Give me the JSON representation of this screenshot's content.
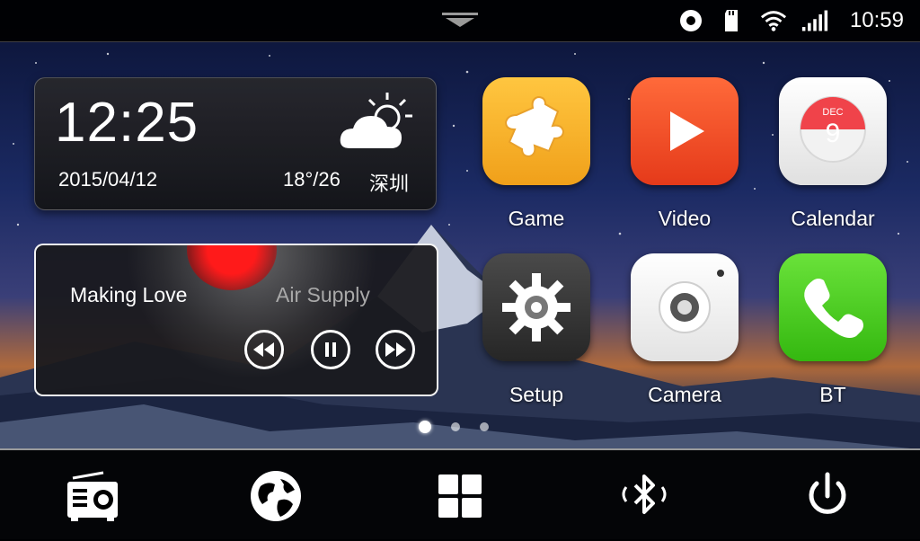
{
  "status_bar": {
    "time": "10:59",
    "icons": [
      "record-icon",
      "sd-card-icon",
      "wifi-icon",
      "signal-icon"
    ],
    "pull_handle": "chevron-down-icon"
  },
  "clock_widget": {
    "time": "12:25",
    "date": "2015/04/12",
    "temperature": "18°/26",
    "city": "深圳",
    "weather_icon": "partly-cloudy-icon"
  },
  "music_widget": {
    "title": "Making Love",
    "artist": "Air Supply",
    "controls": [
      "rewind",
      "pause",
      "fast-forward"
    ]
  },
  "apps": [
    {
      "label": "Game",
      "icon": "puzzle-icon",
      "color": "#f5a91f"
    },
    {
      "label": "Video",
      "icon": "play-icon",
      "color": "#f04a22"
    },
    {
      "label": "Calendar",
      "icon": "calendar-icon",
      "color": "#f1f1f1",
      "month": "DEC",
      "day": "9"
    },
    {
      "label": "Setup",
      "icon": "gear-icon",
      "color": "#3a3a3a"
    },
    {
      "label": "Camera",
      "icon": "camera-icon",
      "color": "#eeeeee"
    },
    {
      "label": "BT",
      "icon": "phone-icon",
      "color": "#4ccf1d"
    }
  ],
  "pager": {
    "pages": 3,
    "active": 0
  },
  "dock": [
    "radio-icon",
    "globe-icon",
    "apps-grid-icon",
    "bluetooth-icon",
    "power-icon"
  ]
}
